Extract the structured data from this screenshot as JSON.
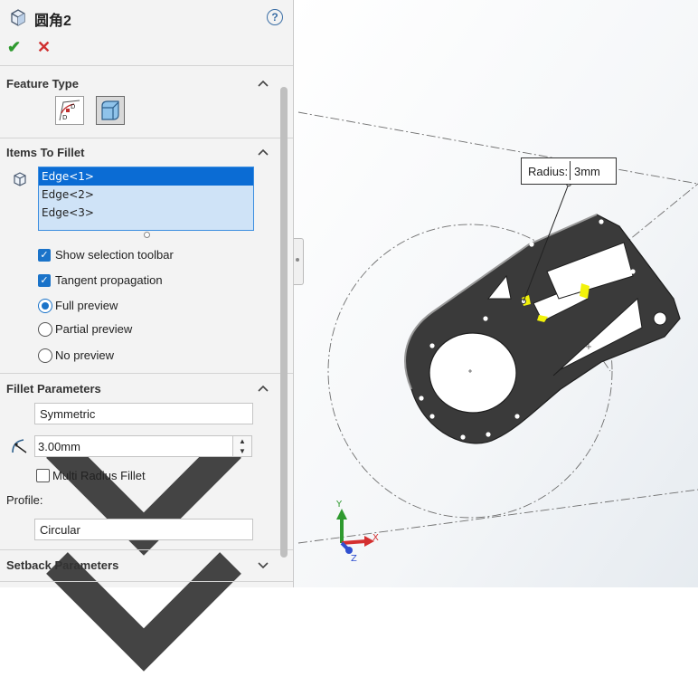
{
  "header": {
    "title": "圆角2",
    "feature_icon": "fillet-cube-icon",
    "help": "?"
  },
  "actions": {
    "ok": "✔",
    "cancel": "✕"
  },
  "feature_type": {
    "heading": "Feature Type",
    "buttons": [
      {
        "icon": "constant-size-fillet-icon",
        "selected": false
      },
      {
        "icon": "face-fillet-cube-icon",
        "selected": true
      }
    ]
  },
  "items_to_fillet": {
    "heading": "Items To Fillet",
    "items": [
      "Edge<1>",
      "Edge<2>",
      "Edge<3>"
    ],
    "selected_index": 0,
    "options": [
      {
        "label": "Show selection toolbar",
        "type": "checkbox",
        "checked": true
      },
      {
        "label": "Tangent propagation",
        "type": "checkbox",
        "checked": true
      },
      {
        "label": "Full preview",
        "type": "radio",
        "checked": true
      },
      {
        "label": "Partial preview",
        "type": "radio",
        "checked": false
      },
      {
        "label": "No preview",
        "type": "radio",
        "checked": false
      }
    ]
  },
  "fillet_parameters": {
    "heading": "Fillet Parameters",
    "symmetry": "Symmetric",
    "radius": "3.00mm",
    "multi_radius_label": "Multi Radius Fillet",
    "multi_radius_checked": false,
    "profile_label": "Profile:",
    "profile": "Circular"
  },
  "setback": {
    "heading": "Setback Parameters"
  },
  "viewport": {
    "callout_label": "Radius:",
    "callout_value": "3mm",
    "triad": {
      "x": "X",
      "y": "Y",
      "z": "Z"
    },
    "colors": {
      "part": "#3a3a3a",
      "highlight": "#f2f20a",
      "x_axis": "#d43030",
      "y_axis": "#2f9a2f",
      "z_axis": "#3050d0"
    }
  }
}
